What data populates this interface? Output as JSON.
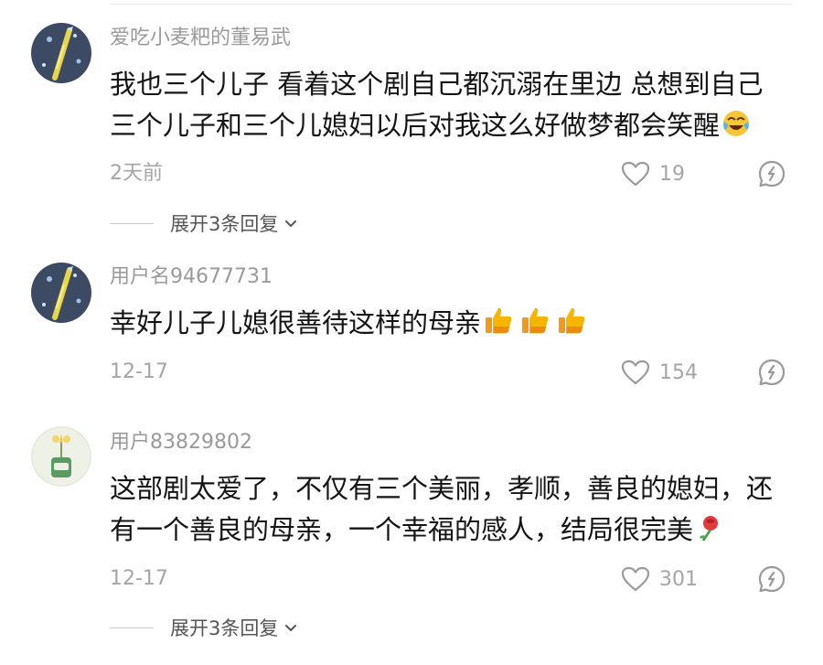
{
  "comments": [
    {
      "username": "爱吃小麦粑的董易武",
      "content_lines": [
        "我也三个儿子 看着这个剧自己都沉溺在里边 总想到自己",
        "三个儿子和三个儿媳妇以后对我这么好做梦都会笑醒"
      ],
      "emoji": "crying-laughing-emoji",
      "date": "2天前",
      "likes": "19",
      "expand_label": "展开3条回复"
    },
    {
      "username": "用户名94677731",
      "content_lines": [
        "幸好儿子儿媳很善待这样的母亲"
      ],
      "emoji": "thumbs-up-emoji ×3",
      "date": "12-17",
      "likes": "154"
    },
    {
      "username": "用户83829802",
      "content_lines": [
        "这部剧太爱了，不仅有三个美丽，孝顺，善良的媳妇，还",
        "有一个善良的母亲，一个幸福的感人，结局很完美"
      ],
      "emoji": "rose-emoji",
      "date": "12-17",
      "likes": "301",
      "expand_label": "展开3条回复"
    }
  ],
  "icons": {
    "like": "heart-outline-icon",
    "reply": "reply-bubble-icon",
    "chevron": "chevron-down-icon"
  },
  "colors": {
    "username": "#9a9a9a",
    "text": "#141414",
    "meta": "#a5a5a5"
  }
}
